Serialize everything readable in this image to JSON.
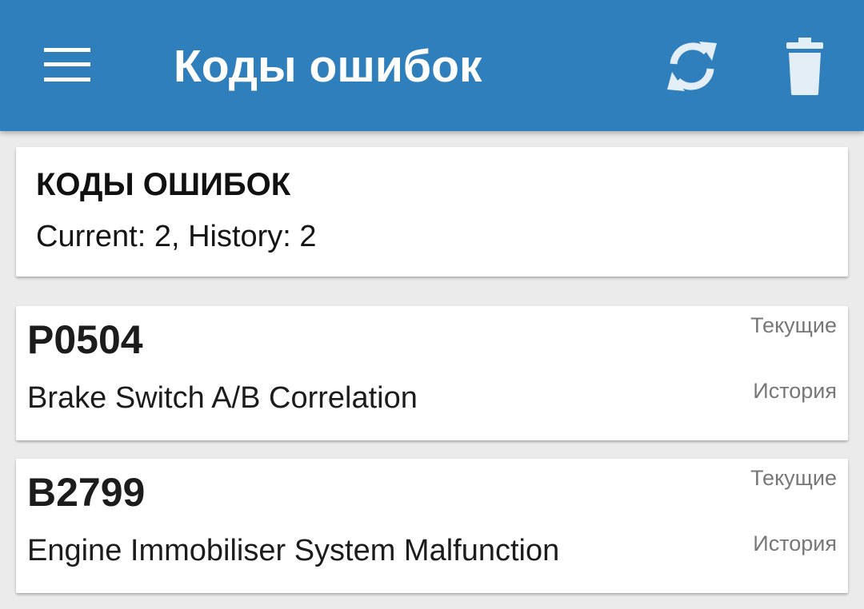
{
  "appbar": {
    "title": "Коды ошибок",
    "menu_icon": "menu-icon",
    "refresh_icon": "refresh-icon",
    "delete_icon": "trash-icon",
    "color": "#2f7fbd"
  },
  "summary": {
    "title": "КОДЫ ОШИБОК",
    "text": "Current: 2, History: 2"
  },
  "codes": [
    {
      "code": "P0504",
      "description": "Brake Switch A/B Correlation",
      "status_current": "Текущие",
      "status_history": "История"
    },
    {
      "code": "B2799",
      "description": "Engine Immobiliser System Malfunction",
      "status_current": "Текущие",
      "status_history": "История"
    }
  ]
}
